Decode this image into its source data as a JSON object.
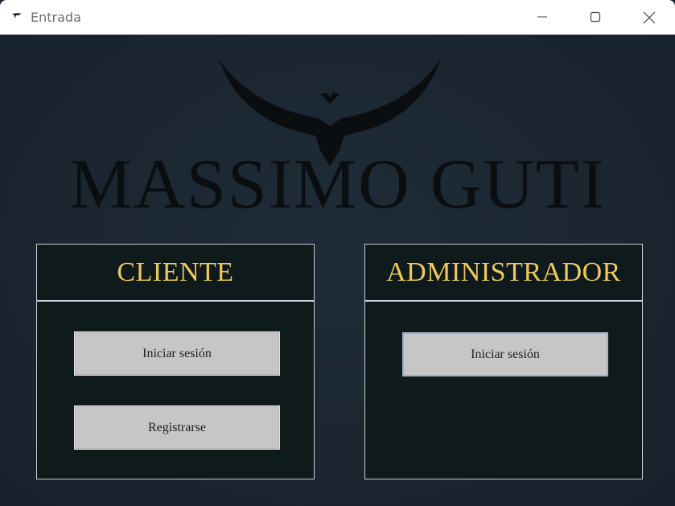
{
  "window": {
    "title": "Entrada"
  },
  "logo": {
    "text": "MASSIMO GUTI"
  },
  "cliente": {
    "title": "CLIENTE",
    "login_label": "Iniciar sesión",
    "register_label": "Registrarse"
  },
  "administrador": {
    "title": "ADMINISTRADOR",
    "login_label": "Iniciar sesión"
  },
  "colors": {
    "background": "#1b2530",
    "panel": "#0f1a1b",
    "panel_title": "#eec85a",
    "button": "#c8c5c6",
    "logo": "#0b0e11"
  },
  "icons": {
    "app": "feather-app-icon",
    "minimize": "minimize-icon",
    "maximize": "maximize-icon",
    "close": "close-icon",
    "logo": "eagle-logo-icon"
  }
}
